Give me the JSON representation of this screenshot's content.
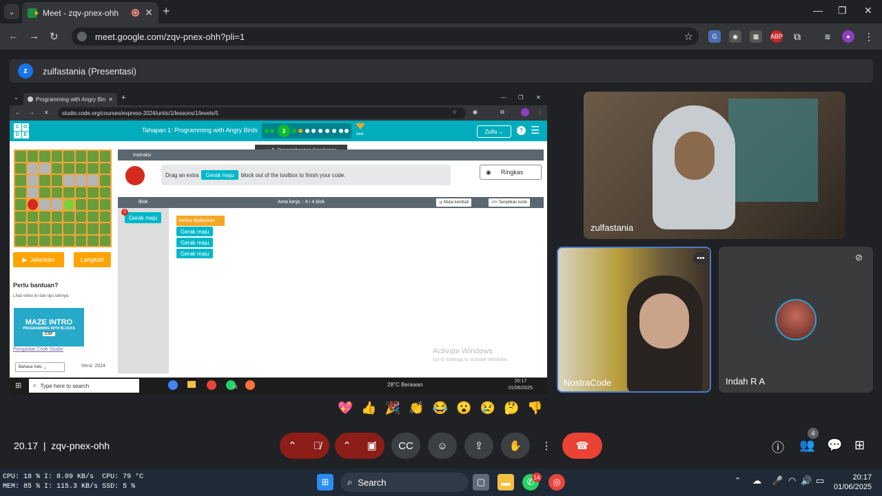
{
  "browser": {
    "tab_title": "Meet - zqv-pnex-ohh",
    "url": "meet.google.com/zqv-pnex-ohh?pli=1",
    "extensions": [
      "translate-icon",
      "incognito-icon",
      "qr-icon",
      "adblock-icon",
      "extensions-icon"
    ]
  },
  "presentation": {
    "avatar_letter": "z",
    "label": "zulfastania (Presentasi)"
  },
  "shared": {
    "tab_title": "Programming with Angry Birds",
    "url": "studio.code.org/courses/express-2024/units/1/lessons/1/levels/5",
    "logo_letters": [
      "C",
      "O",
      "D",
      "E"
    ],
    "lesson_title": "Tahapan 1: Programming with Angry Birds",
    "current_level": "3",
    "more_label": "lebih",
    "tooltip": "5. Pengembangan Kecakapan",
    "user_menu": "Zulfa",
    "run_label": "Jalankan",
    "step_label": "Langkah",
    "help_title": "Perlu bantuan?",
    "help_sub": "Lihat video ini dan tips lainnya",
    "video_title": "MAZE INTRO",
    "video_sub": "PROGRAMMING WITH BLOCKS",
    "video_badge": "CSF",
    "video_link": "Pengantar Code Studio",
    "language": "Bahasa Indo",
    "version": "Versi: 2024",
    "instr_tab": "Instruksi",
    "instr_pre": "Drag an extra",
    "instr_block": "Gerak maju",
    "instr_post": "block out of the toolbox to finish your code.",
    "collapse_label": "Ringkas",
    "toolbox_label": "Blok",
    "workspace_label": "Area kerja: : 4 / 4 blok",
    "reset_label": "Mulai kembali",
    "show_code_label": "Tampilkan kode",
    "toolbox_block": "Gerak maju",
    "toolbox_count": "0",
    "event_block": "ketika dijalankan",
    "program_blocks": [
      "Gerak maju",
      "Gerak maju",
      "Gerak maju"
    ],
    "watermark_title": "Activate Windows",
    "watermark_sub": "Go to Settings to activate Windows",
    "taskbar_search": "Type here to search",
    "weather": "28°C Berawan",
    "time": "20:17",
    "date": "01/06/2025",
    "whatsapp_badge": "15"
  },
  "participants": [
    {
      "name": "zulfastania"
    },
    {
      "name": "NostraCode"
    },
    {
      "name": "Indah R A"
    }
  ],
  "reactions": [
    "💖",
    "👍",
    "🎉",
    "👏",
    "😂",
    "😮",
    "😢",
    "🤔",
    "👎"
  ],
  "bottom_bar": {
    "time": "20.17",
    "meeting_code": "zqv-pnex-ohh",
    "people_count": "4"
  },
  "windows_taskbar": {
    "search": "Search",
    "time": "20:17",
    "date": "01/06/2025",
    "whatsapp_badge": "14",
    "stats": {
      "cpu": "CPU: 18 %",
      "mem": "MEM: 85 %",
      "upload": "I: 8.09 KB/s",
      "download": "I: 115.3 KB/s",
      "cpu_temp": "CPU: 79 °C",
      "ssd": "SSD: 5 %"
    }
  },
  "colors": {
    "code_teal": "#00adbc",
    "block_cyan": "#00b8c8",
    "orange": "#ffa400",
    "end_call": "#ea4335",
    "muted": "#8c1d18"
  }
}
